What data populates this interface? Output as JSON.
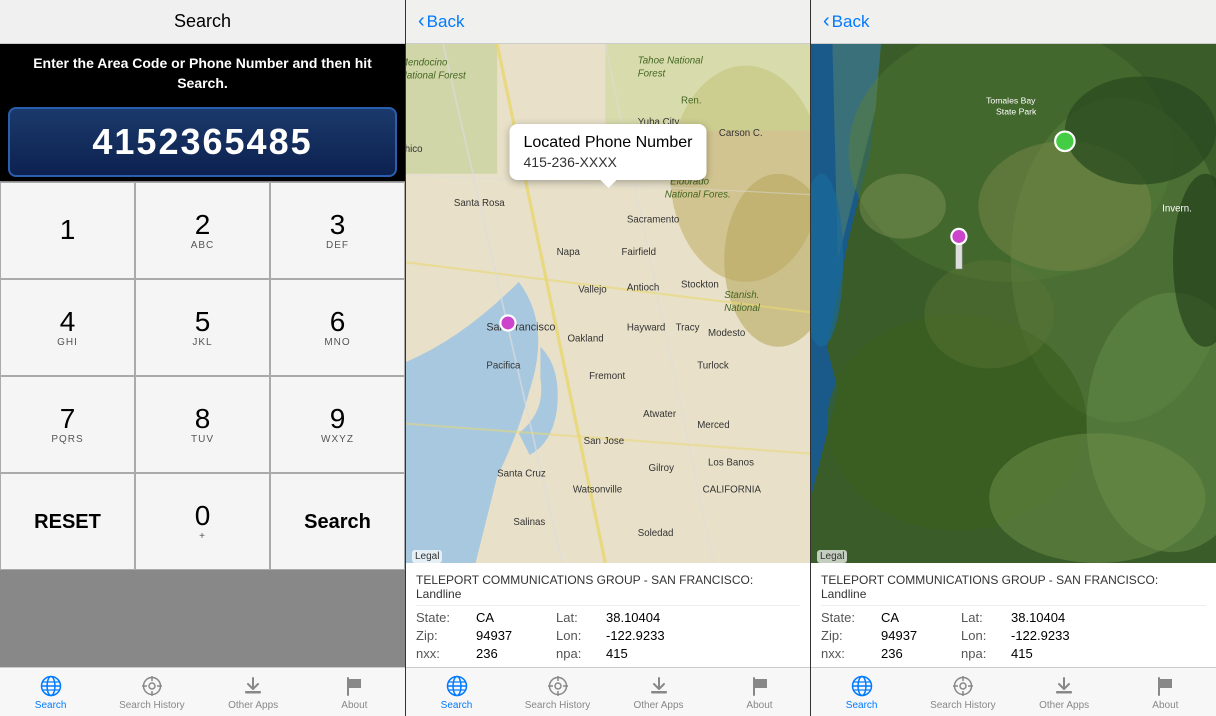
{
  "panel1": {
    "header": "Search",
    "instruction": "Enter the Area Code or Phone Number and then hit Search.",
    "display_number": "4152365485",
    "keys": [
      {
        "digit": "1",
        "letters": ""
      },
      {
        "digit": "2",
        "letters": "ABC"
      },
      {
        "digit": "3",
        "letters": "DEF"
      },
      {
        "digit": "4",
        "letters": "GHI"
      },
      {
        "digit": "5",
        "letters": "JKL"
      },
      {
        "digit": "6",
        "letters": "MNO"
      },
      {
        "digit": "7",
        "letters": "PQRS"
      },
      {
        "digit": "8",
        "letters": "TUV"
      },
      {
        "digit": "9",
        "letters": "WXYZ"
      },
      {
        "digit": "RESET",
        "letters": ""
      },
      {
        "digit": "0",
        "letters": "+"
      },
      {
        "digit": "Search",
        "letters": ""
      }
    ],
    "tabs": [
      {
        "label": "Search",
        "active": true
      },
      {
        "label": "Search History",
        "active": false
      },
      {
        "label": "Other Apps",
        "active": false
      },
      {
        "label": "About",
        "active": false
      }
    ]
  },
  "panel2": {
    "back_label": "Back",
    "map_popup_title": "Located Phone Number",
    "map_popup_phone": "415-236-XXXX",
    "info_title": "TELEPORT COMMUNICATIONS GROUP - SAN FRANCISCO: Landline",
    "info": {
      "state_label": "State:",
      "state_val": "CA",
      "lat_label": "Lat:",
      "lat_val": "38.10404",
      "zip_label": "Zip:",
      "zip_val": "94937",
      "lon_label": "Lon:",
      "lon_val": "-122.9233",
      "nxx_label": "nxx:",
      "nxx_val": "236",
      "npa_label": "npa:",
      "npa_val": "415"
    },
    "legal": "Legal",
    "tabs": [
      {
        "label": "Search",
        "active": true
      },
      {
        "label": "Search History",
        "active": false
      },
      {
        "label": "Other Apps",
        "active": false
      },
      {
        "label": "About",
        "active": false
      }
    ]
  },
  "panel3": {
    "back_label": "Back",
    "info_title": "TELEPORT COMMUNICATIONS GROUP - SAN FRANCISCO: Landline",
    "info": {
      "state_label": "State:",
      "state_val": "CA",
      "lat_label": "Lat:",
      "lat_val": "38.10404",
      "zip_label": "Zip:",
      "zip_val": "94937",
      "lon_label": "Lon:",
      "lon_val": "-122.9233",
      "nxx_label": "nxx:",
      "nxx_val": "236",
      "npa_label": "npa:",
      "npa_val": "415"
    },
    "legal": "Legal",
    "tabs": [
      {
        "label": "Search",
        "active": true
      },
      {
        "label": "Search History",
        "active": false
      },
      {
        "label": "Other Apps",
        "active": false
      },
      {
        "label": "About",
        "active": false
      }
    ]
  },
  "icons": {
    "globe": "🌐",
    "crosshair": "⊕",
    "download": "⬇",
    "flag": "⚑",
    "back_chevron": "❮"
  }
}
